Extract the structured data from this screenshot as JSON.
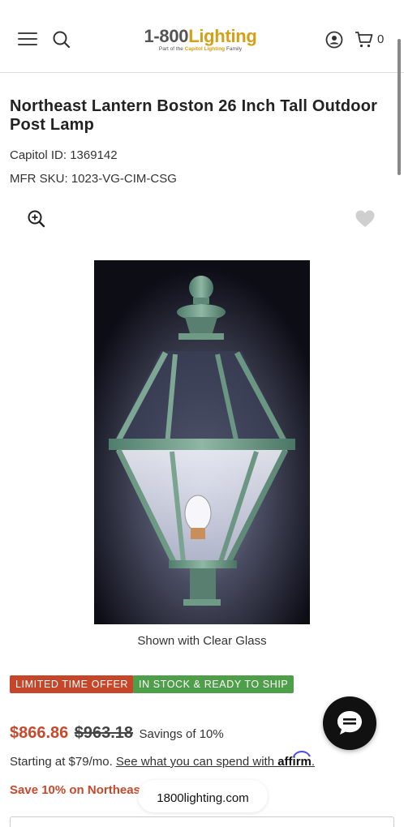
{
  "header": {
    "logo_main_prefix": "1-800",
    "logo_main_accent": "Lighting",
    "logo_tag_prefix": "Part of the ",
    "logo_tag_brand": "Capitol Lighting",
    "logo_tag_suffix": " Family",
    "cart_count": "0",
    "icons": [
      "menu-icon",
      "search-icon",
      "account-icon",
      "cart-icon"
    ]
  },
  "product": {
    "title": "Northeast Lantern Boston 26 Inch Tall Outdoor Post Lamp",
    "capitol_id": "Capitol ID: 1369142",
    "mfr_sku": "MFR SKU: 1023-VG-CIM-CSG",
    "image_caption": "Shown with Clear Glass"
  },
  "badges": {
    "offer": "LIMITED TIME OFFER",
    "stock": "IN STOCK & READY TO SHIP"
  },
  "pricing": {
    "sale_price": "$866.86",
    "original_price": "$963.18",
    "savings": "Savings of 10%"
  },
  "financing": {
    "prefix": "Starting at $79/mo.",
    "link": "See what you can spend with",
    "brand": "affirm",
    "suffix": "."
  },
  "promo": {
    "text": "Save 10% on Northeast"
  },
  "browser": {
    "url": "1800lighting.com"
  },
  "colors": {
    "sale_red": "#c9482b",
    "offer_badge": "#c6462a",
    "stock_badge": "#4f9e4a",
    "logo_gold": "#d4a017"
  }
}
